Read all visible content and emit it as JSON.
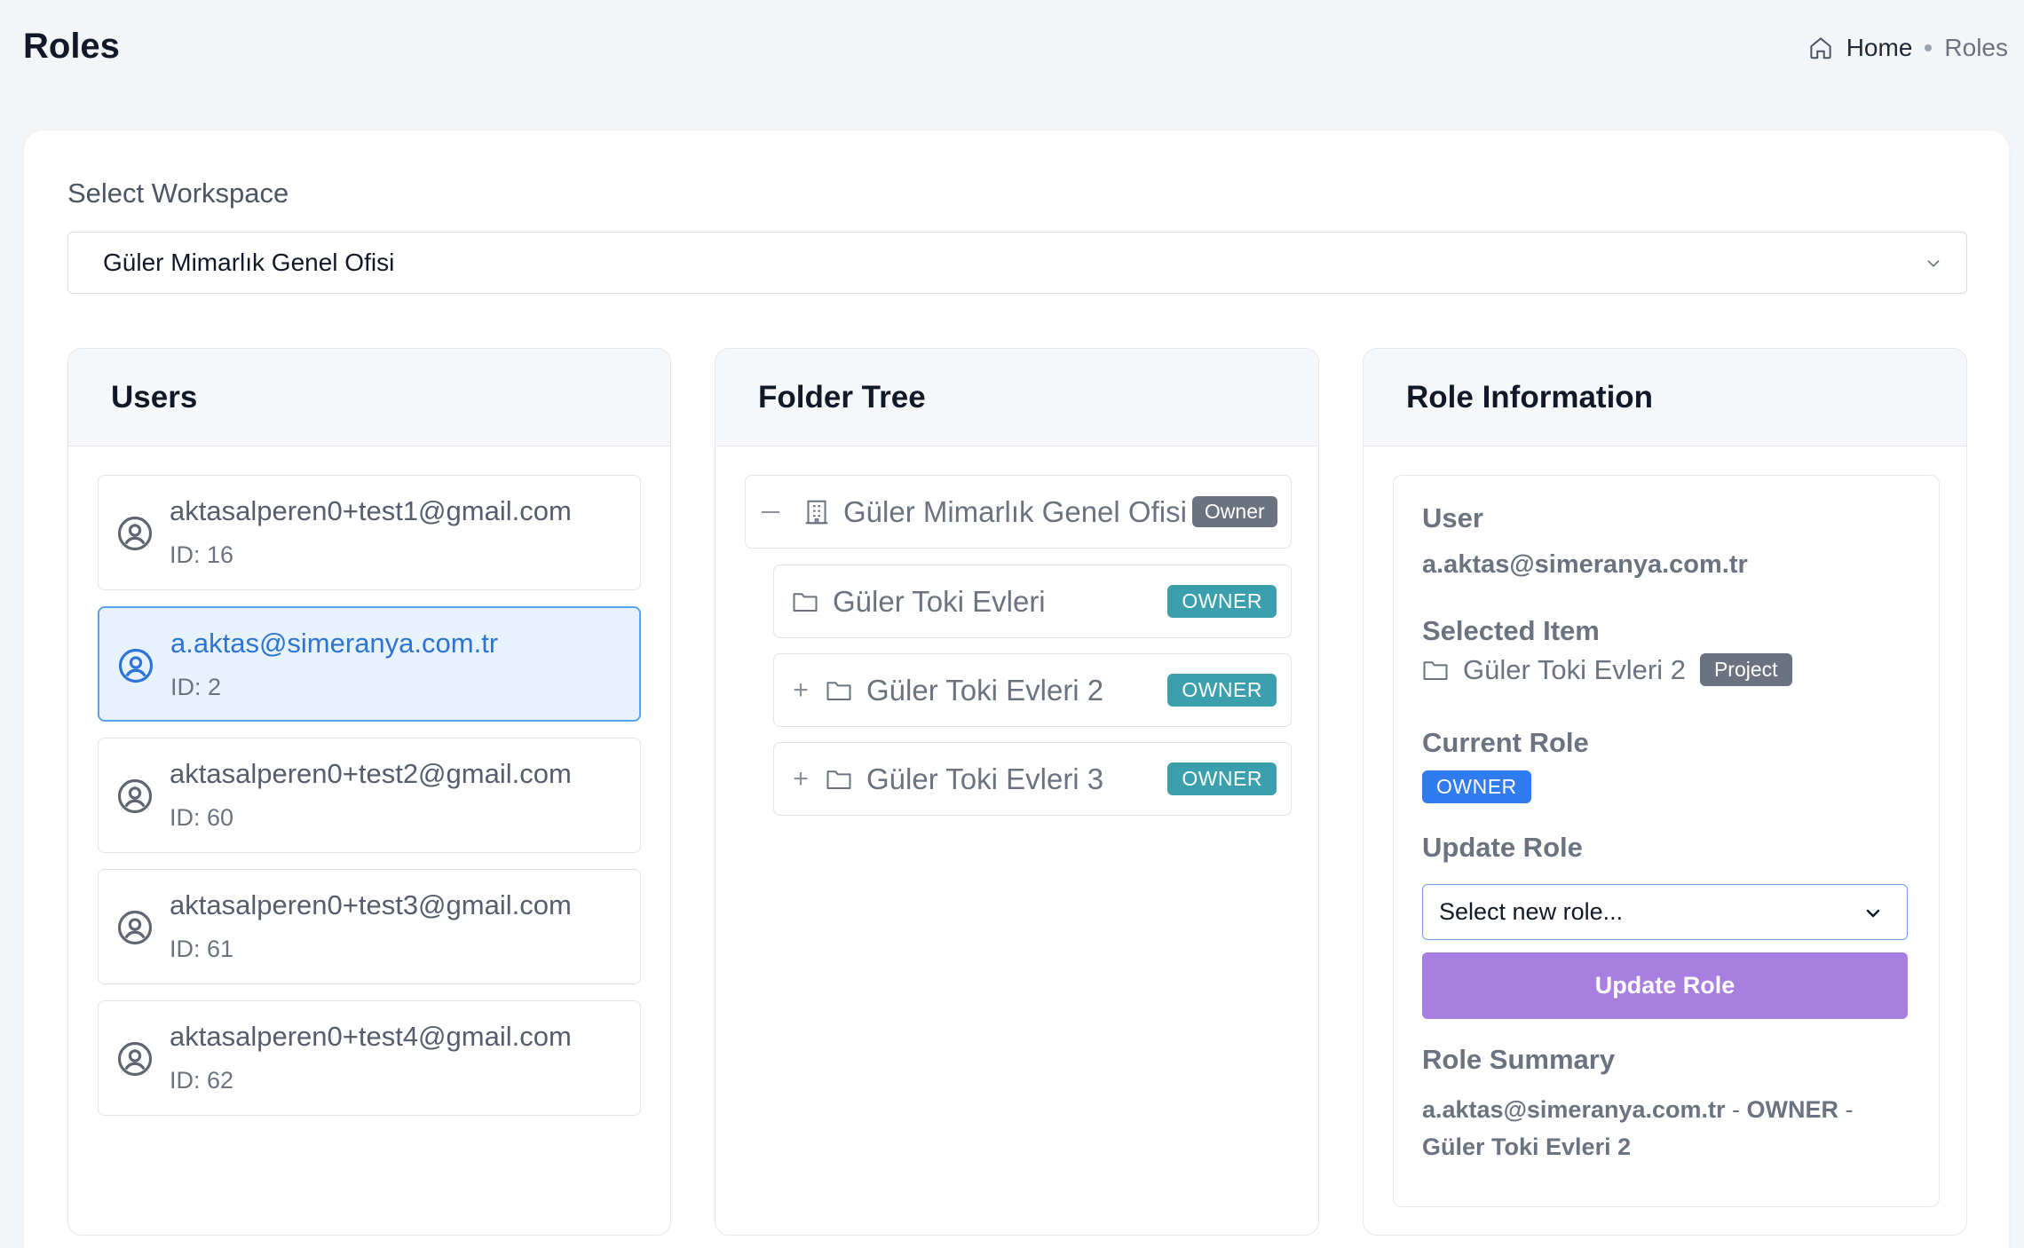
{
  "page": {
    "title": "Roles"
  },
  "breadcrumb": {
    "home": "Home",
    "current": "Roles"
  },
  "workspace": {
    "label": "Select Workspace",
    "selected": "Güler Mimarlık Genel Ofisi"
  },
  "users": {
    "title": "Users",
    "items": [
      {
        "email": "aktasalperen0+test1@gmail.com",
        "id": "ID: 16",
        "selected": false
      },
      {
        "email": "a.aktas@simeranya.com.tr",
        "id": "ID: 2",
        "selected": true
      },
      {
        "email": "aktasalperen0+test2@gmail.com",
        "id": "ID: 60",
        "selected": false
      },
      {
        "email": "aktasalperen0+test3@gmail.com",
        "id": "ID: 61",
        "selected": false
      },
      {
        "email": "aktasalperen0+test4@gmail.com",
        "id": "ID: 62",
        "selected": false
      }
    ]
  },
  "folder_tree": {
    "title": "Folder Tree",
    "root": {
      "name": "Güler Mimarlık Genel Ofisi",
      "badge": "Owner"
    },
    "children": [
      {
        "name": "Güler Toki Evleri",
        "badge": "OWNER",
        "expandable": false
      },
      {
        "name": "Güler Toki Evleri 2",
        "badge": "OWNER",
        "expandable": true,
        "toggle": "+"
      },
      {
        "name": "Güler Toki Evleri 3",
        "badge": "OWNER",
        "expandable": true,
        "toggle": "+"
      }
    ]
  },
  "role_info": {
    "title": "Role Information",
    "user_label": "User",
    "user_value": "a.aktas@simeranya.com.tr",
    "selected_label": "Selected Item",
    "selected_name": "Güler Toki Evleri 2",
    "selected_badge": "Project",
    "current_label": "Current Role",
    "current_badge": "OWNER",
    "update_label": "Update Role",
    "select_placeholder": "Select new role...",
    "update_button": "Update Role",
    "summary_label": "Role Summary",
    "summary_user": "a.aktas@simeranya.com.tr",
    "summary_dash": " - ",
    "summary_role": "OWNER",
    "summary_dash2": " -",
    "summary_item": "Güler Toki Evleri 2"
  },
  "colors": {
    "accent_blue": "#2f7bef",
    "owner_teal": "#3c9fae",
    "button_purple": "#a87ee0",
    "selected_bg": "#e8f2fd"
  }
}
